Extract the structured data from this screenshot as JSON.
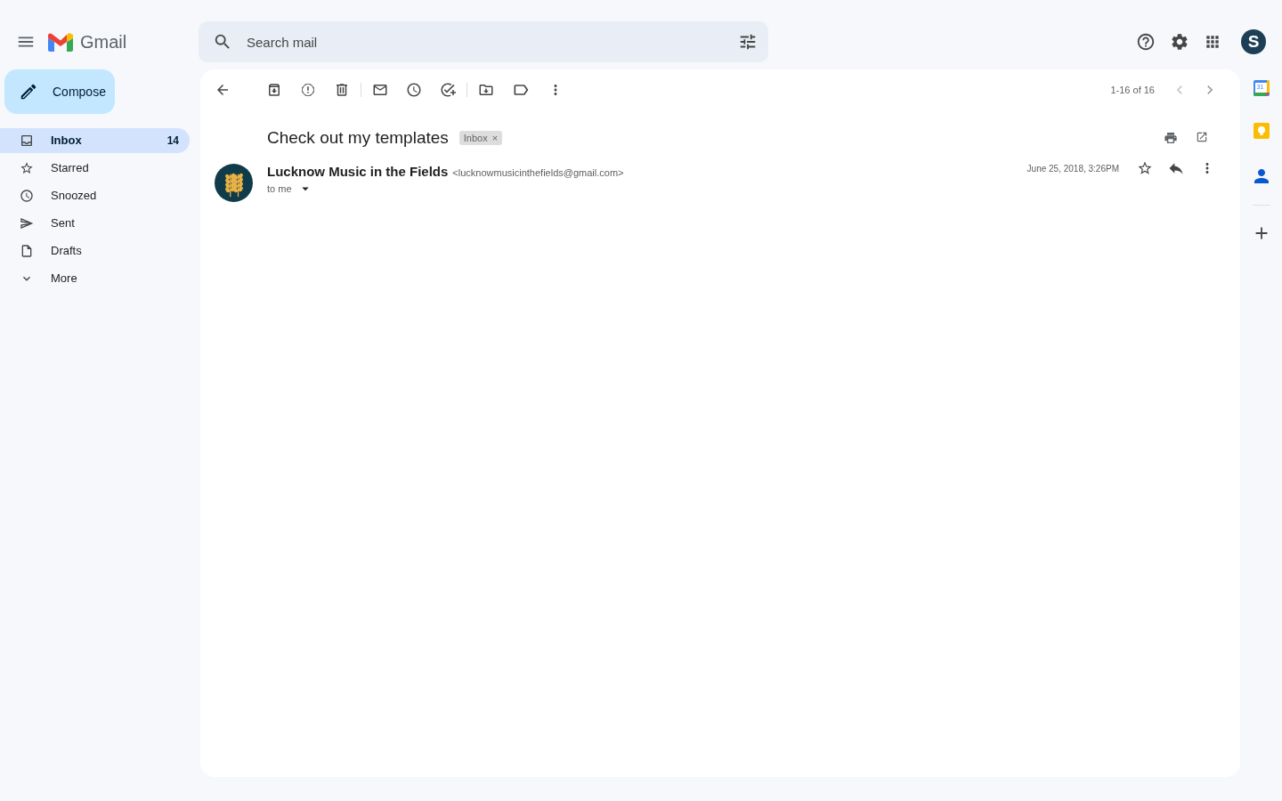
{
  "header": {
    "app_name": "Gmail",
    "search": {
      "placeholder": "Search mail"
    },
    "avatar_letter": "S"
  },
  "compose": {
    "label": "Compose"
  },
  "sidebar": {
    "items": [
      {
        "label": "Inbox",
        "count": "14",
        "selected": true
      },
      {
        "label": "Starred",
        "selected": false
      },
      {
        "label": "Snoozed",
        "selected": false
      },
      {
        "label": "Sent",
        "selected": false
      },
      {
        "label": "Drafts",
        "selected": false
      },
      {
        "label": "More",
        "selected": false
      }
    ]
  },
  "toolbar": {
    "pagination": "1-16 of 16"
  },
  "message": {
    "subject": "Check out my templates",
    "labels": [
      {
        "name": "Inbox",
        "remove": "×"
      }
    ],
    "sender_name": "Lucknow Music in the Fields",
    "sender_email": "<lucknowmusicinthefields@gmail.com>",
    "recipient": "to me",
    "date": "June 25, 2018, 3:26PM"
  },
  "side_panel": {
    "calendar_day": "31"
  }
}
